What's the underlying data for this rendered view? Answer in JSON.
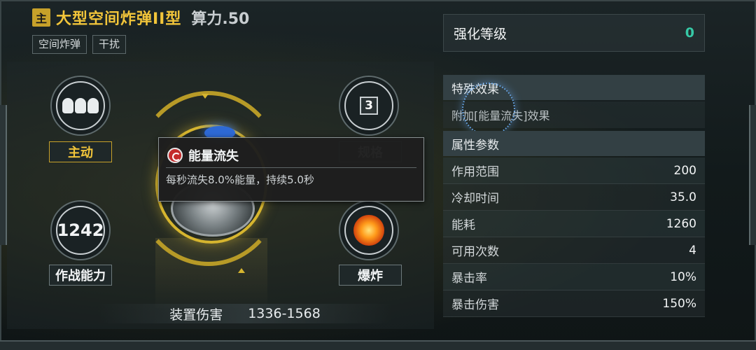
{
  "header": {
    "badge": "主",
    "title": "大型空间炸弹II型",
    "power": "算力.50",
    "tags": [
      "空间炸弹",
      "干扰"
    ]
  },
  "left": {
    "nodes": {
      "top_left_label": "主动",
      "bottom_left_value": "1242",
      "bottom_left_label": "作战能力",
      "top_right_value": "3",
      "top_right_label": "规格",
      "bottom_right_label": "爆炸"
    },
    "damage": {
      "label": "装置伤害",
      "value": "1336-1568"
    }
  },
  "tooltip": {
    "title": "能量流失",
    "description": "每秒流失8.0%能量，持续5.0秒"
  },
  "right": {
    "enhance": {
      "label": "强化等级",
      "value": "0"
    },
    "special": {
      "header": "特殊效果",
      "description": "附加[能量流失]效果"
    },
    "attributes": {
      "header": "属性参数",
      "rows": [
        {
          "label": "作用范围",
          "value": "200"
        },
        {
          "label": "冷却时间",
          "value": "35.0"
        },
        {
          "label": "能耗",
          "value": "1260"
        },
        {
          "label": "可用次数",
          "value": "4"
        },
        {
          "label": "暴击率",
          "value": "10%"
        },
        {
          "label": "暴击伤害",
          "value": "150%"
        }
      ]
    }
  },
  "colors": {
    "title_gold": "#f2c53a",
    "enhance_value": "#36c9a6",
    "ring_gold": "#d6b52f"
  }
}
